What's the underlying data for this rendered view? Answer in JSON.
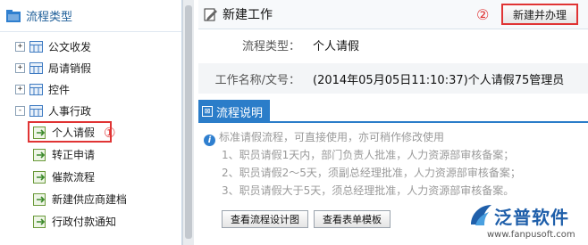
{
  "sidebar": {
    "title": "流程类型",
    "nodes": [
      {
        "toggle": "+",
        "label": "公文收发"
      },
      {
        "toggle": "+",
        "label": "局请销假"
      },
      {
        "toggle": "+",
        "label": "控件"
      },
      {
        "toggle": "-",
        "label": "人事行政"
      }
    ],
    "leaves": [
      {
        "label": "个人请假"
      },
      {
        "label": "转正申请"
      },
      {
        "label": "催款流程"
      },
      {
        "label": "新建供应商建档"
      },
      {
        "label": "行政付款通知"
      }
    ],
    "marker": "①"
  },
  "main": {
    "title": "新建工作",
    "marker": "②",
    "new_button": "新建并办理",
    "fields": [
      {
        "key": "流程类型：",
        "value": "个人请假"
      },
      {
        "key": "工作名称/文号：",
        "value": "(2014年05月05日11:10:37)个人请假75管理员"
      }
    ],
    "section_tab": "流程说明",
    "description": {
      "intro": "标准请假流程，可直接使用，亦可稍作修改使用",
      "lines": [
        "1、职员请假1天内，部门负责人批准，人力资源部审核备案；",
        "2、职员请假2～5天，须副总经理批准，人力资源部审核备案；",
        "3、职员请假大于5天，须总经理批准，人力资源部审核备案。"
      ]
    },
    "buttons": {
      "design": "查看流程设计图",
      "form": "查看表单模板"
    }
  },
  "brand": {
    "name": "泛普软件",
    "url": "www.fanpusoft.com"
  },
  "colors": {
    "accent": "#2b7dc9",
    "highlight": "#e03434",
    "brand": "#1f5faa"
  }
}
